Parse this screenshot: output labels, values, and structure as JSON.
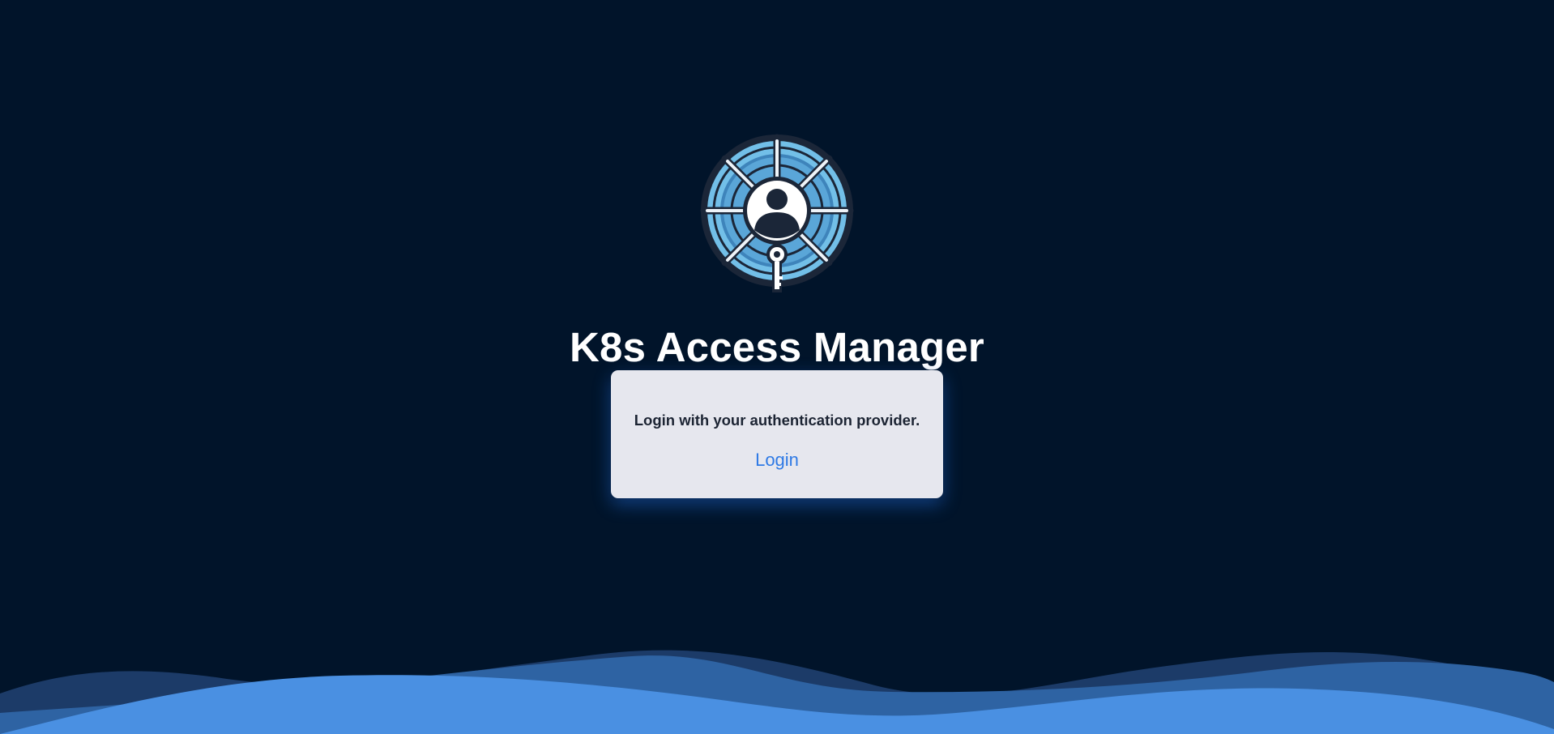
{
  "app": {
    "title": "K8s Access Manager",
    "logo_icon": "shield-user-key-icon"
  },
  "login_card": {
    "message": "Login with your authentication provider.",
    "login_label": "Login"
  },
  "colors": {
    "background": "#01142a",
    "wave_light": "#4a90e2",
    "wave_mid": "#2e63a3",
    "card_background": "#e6e7ee",
    "link": "#2f7ae5"
  }
}
